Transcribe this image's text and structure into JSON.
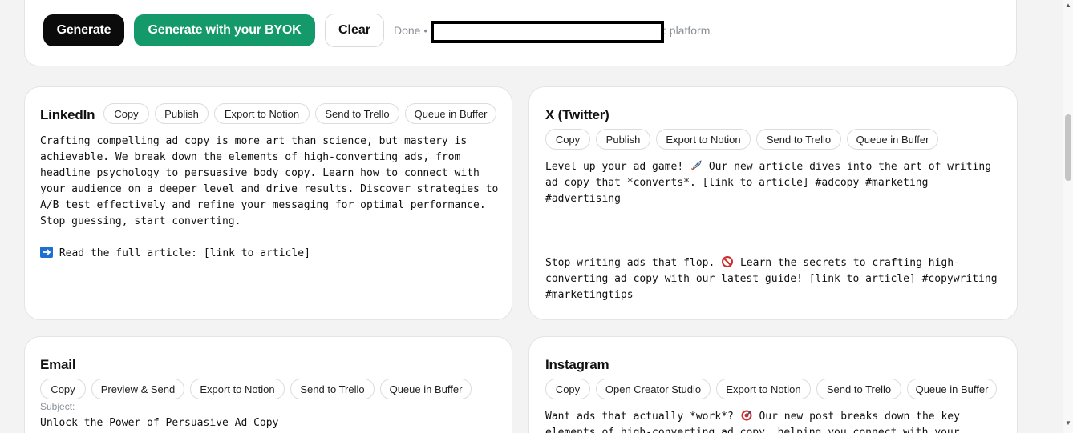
{
  "toolbar": {
    "generate_label": "Generate",
    "byok_label": "Generate with your BYOK",
    "clear_label": "Clear",
    "status_text": "Done •",
    "status_suffix": ": platform"
  },
  "colors": {
    "primary_dark": "#0b0b0b",
    "brand_green": "#13996a",
    "muted_text": "#8a8f98"
  },
  "cards": {
    "linkedin": {
      "title": "LinkedIn",
      "actions": [
        "Copy",
        "Publish",
        "Export to Notion",
        "Send to Trello",
        "Queue in Buffer"
      ],
      "body": "Crafting compelling ad copy is more art than science, but mastery is\nachievable. We break down the elements of high-converting ads, from\nheadline psychology to persuasive body copy. Learn how to connect with\nyour audience on a deeper level and drive results. Discover strategies to\nA/B test effectively and refine your messaging for optimal performance.\nStop guessing, start converting.",
      "cta": " Read the full article: [link to article]",
      "cta_icon": "arrow-right-icon"
    },
    "twitter": {
      "title": "X (Twitter)",
      "actions": [
        "Copy",
        "Publish",
        "Export to Notion",
        "Send to Trello",
        "Queue in Buffer"
      ],
      "line1_a": "Level up your ad game! ",
      "line1_b": " Our new article dives into the art of writing\nad copy that *converts*. [link to article] #adcopy #marketing\n#advertising",
      "separator": "—",
      "line2_a": "Stop writing ads that flop. ",
      "line2_b": " Learn the secrets to crafting high-\nconverting ad copy with our latest guide! [link to article] #copywriting\n#marketingtips",
      "icon1": "rocket-icon",
      "icon2": "prohibited-icon"
    },
    "email": {
      "title": "Email",
      "actions": [
        "Copy",
        "Preview & Send",
        "Export to Notion",
        "Send to Trello",
        "Queue in Buffer"
      ],
      "subject_label": "Subject:",
      "subject": "Unlock the Power of Persuasive Ad Copy"
    },
    "instagram": {
      "title": "Instagram",
      "actions": [
        "Copy",
        "Open Creator Studio",
        "Export to Notion",
        "Send to Trello",
        "Queue in Buffer"
      ],
      "line1_a": "Want ads that actually *work*? ",
      "line1_b": " Our new post breaks down the key",
      "line2": "elements of high-converting ad copy, helping you connect with your",
      "icon1": "target-icon"
    }
  }
}
